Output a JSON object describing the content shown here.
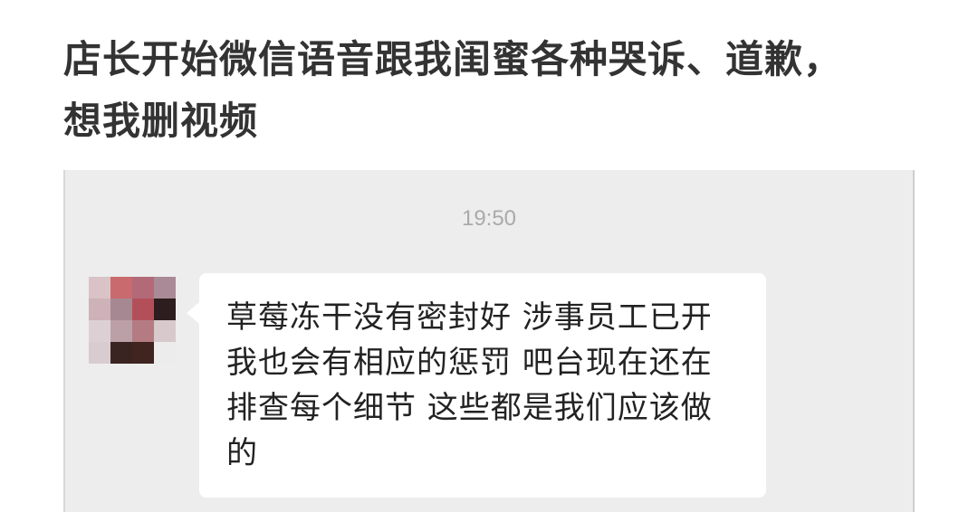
{
  "caption": {
    "text": "店长开始微信语音跟我闺蜜各种哭诉、道歉，想我删视频"
  },
  "chat": {
    "timestamp": "19:50",
    "message": "草莓冻干没有密封好 涉事员工已开 我也会有相应的惩罚 吧台现在还在排查每个细节 这些都是我们应该做的",
    "avatar_pixel_colors": [
      "#d9c3c7",
      "#c96a6e",
      "#b36a78",
      "#a98a96",
      "#cdb2b8",
      "#a58891",
      "#b34f58",
      "#2d1d1e",
      "#ddd0d4",
      "#bca0a8",
      "#b47c82",
      "#d7c9cc",
      "#d8ccd0",
      "#3a2421",
      "#3f2420",
      "#ececec"
    ]
  }
}
